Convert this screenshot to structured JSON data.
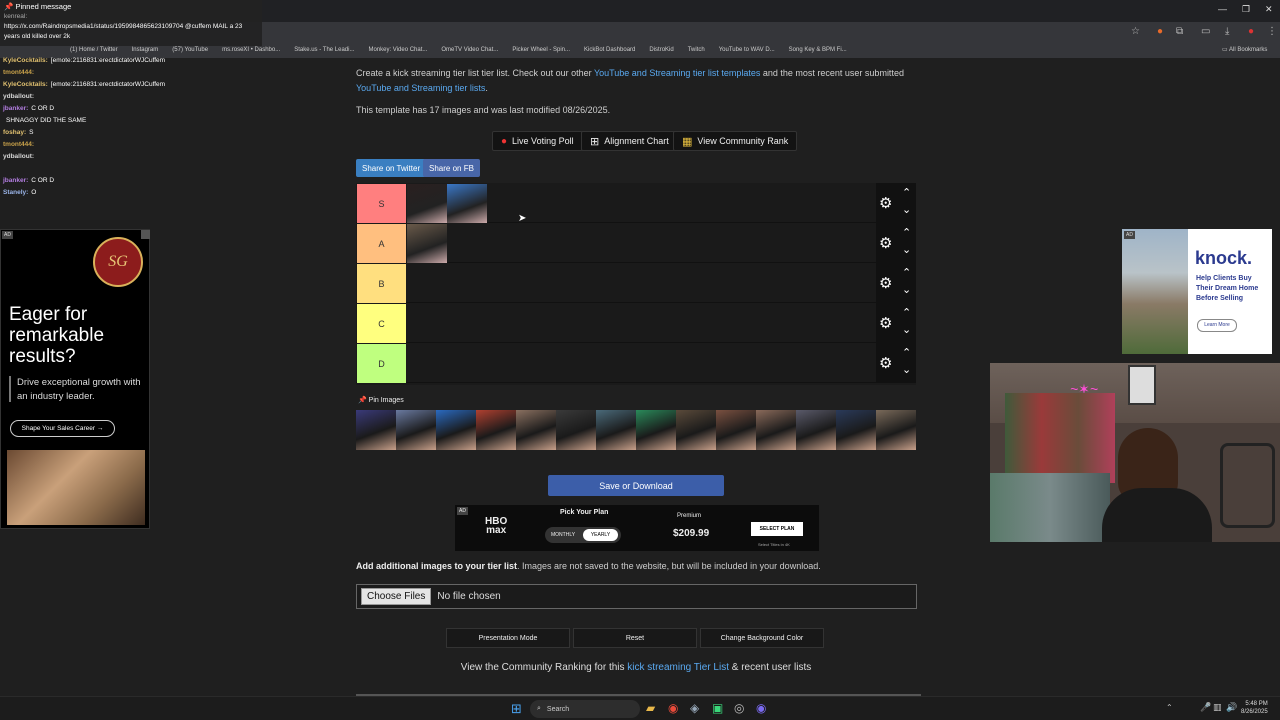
{
  "browser": {
    "bookmarks": [
      "(1) Home / Twitter",
      "Instagram",
      "(57) YouTube",
      "ms.roseXI • Dashbo...",
      "Stake.us - The Leadi...",
      "Monkey: Video Chat...",
      "OmeTV Video Chat...",
      "Picker Wheel - Spin...",
      "KickBot Dashboard",
      "DistroKid",
      "Twitch",
      "YouTube to WAV D...",
      "Song Key & BPM Fi..."
    ],
    "all_bookmarks": "All Bookmarks"
  },
  "page": {
    "intro_prefix": "Create a kick streaming tier list tier list. Check out our other ",
    "intro_link1": "YouTube and Streaming tier list templates",
    "intro_mid": " and the most recent user submitted ",
    "intro_link2": "YouTube and Streaming tier lists",
    "intro_suffix": ".",
    "modified": "This template has 17 images and was last modified 08/26/2025.",
    "tool_buttons": {
      "poll": "Live Voting Poll",
      "alignment": "Alignment Chart",
      "community": "View Community Rank"
    },
    "share": {
      "twitter": "Share on Twitter",
      "fb": "Share on FB"
    },
    "tiers": [
      {
        "label": "S",
        "color": "#ff7f7f",
        "images": 2
      },
      {
        "label": "A",
        "color": "#ffbf7f",
        "images": 1
      },
      {
        "label": "B",
        "color": "#ffdf7f",
        "images": 0
      },
      {
        "label": "C",
        "color": "#ffff7f",
        "images": 0
      },
      {
        "label": "D",
        "color": "#bfff7f",
        "images": 0
      }
    ],
    "pin_label": "Pin Images",
    "pin_count": 14,
    "save_button": "Save or Download",
    "add_images_bold": "Add additional images to your tier list",
    "add_images_rest": ". Images are not saved to the website, but will be included in your download.",
    "choose_files": "Choose Files",
    "no_file": "No file chosen",
    "bottom_buttons": {
      "presentation": "Presentation Mode",
      "reset": "Reset",
      "bg": "Change Background Color"
    },
    "community_prefix": "View the Community Ranking for this ",
    "community_link": "kick streaming Tier List",
    "community_suffix": " & recent user lists"
  },
  "hbo_ad": {
    "ad_tag": "AD",
    "logo_top": "HBO",
    "logo_bottom": "max",
    "headline": "Pick Your Plan",
    "monthly": "MONTHLY",
    "yearly": "YEARLY",
    "tier": "Premium",
    "price": "$209.99",
    "cta": "SELECT PLAN",
    "fine": "Select Titles in 4K"
  },
  "left_ad": {
    "ad_tag": "AD",
    "headline": "Eager for remarkable results?",
    "body": "Drive exceptional growth with an industry leader.",
    "cta": "Shape Your Sales Career →"
  },
  "right_ad": {
    "ad_tag": "AD",
    "brand": "knock.",
    "body": "Help Clients Buy Their Dream Home Before Selling",
    "cta": "Learn More"
  },
  "chat": {
    "pinned_title": "Pinned message",
    "pinned_user": "kenreal:",
    "pinned_text": "https://x.com/Raindropsmedia1/status/1959984865623109704 @cuffem MAIL a 23 years old killed over 2k",
    "messages": [
      {
        "user": "KyleCocktails:",
        "text": "[emote:2116831:erectdictatorWJCuffem",
        "color": "#e0c070"
      },
      {
        "user": "tmont444:",
        "text": "",
        "color": "#c9a24a"
      },
      {
        "user": "KyleCocktails:",
        "text": "[emote:2116831:erectdictatorWJCuffem",
        "color": "#e0c070"
      },
      {
        "user": "ydballout:",
        "text": "",
        "color": "#d8d8d8"
      },
      {
        "user": "jbanker:",
        "text": "C OR D",
        "color": "#b27de0"
      },
      {
        "user": "",
        "text": "SHNAGGY DID THE SAME",
        "color": "#e05050"
      },
      {
        "user": "foshay:",
        "text": "S",
        "color": "#e0c070"
      },
      {
        "user": "tmont444:",
        "text": "",
        "color": "#c9a24a"
      },
      {
        "user": "ydballout:",
        "text": "",
        "color": "#d8d8d8"
      },
      {
        "user": "",
        "text": "",
        "color": "#e05050"
      },
      {
        "user": "jbanker:",
        "text": "C OR D",
        "color": "#b27de0"
      },
      {
        "user": "Stanely:",
        "text": "O",
        "color": "#9ab4e8"
      }
    ]
  },
  "taskbar": {
    "search": "Search",
    "time": "5:48 PM",
    "date": "8/26/2025"
  }
}
